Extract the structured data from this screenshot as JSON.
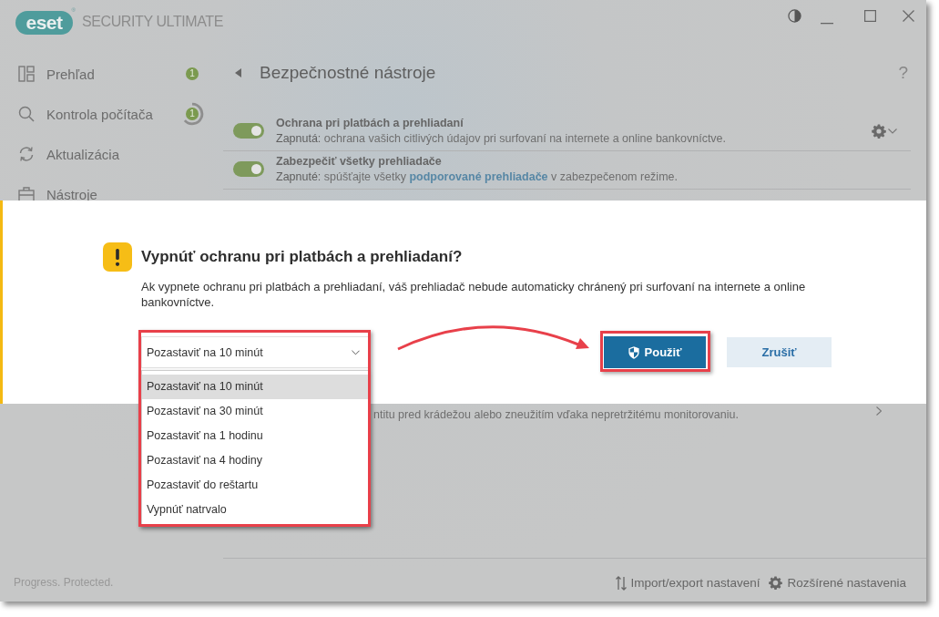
{
  "window": {
    "logo": "eset",
    "logo_mark": "®",
    "product": "SECURITY ULTIMATE"
  },
  "sidebar": {
    "items": [
      {
        "label": "Prehľad",
        "badge": "1",
        "busy": false
      },
      {
        "label": "Kontrola počítača",
        "badge": "1",
        "busy": true
      },
      {
        "label": "Aktualizácia"
      },
      {
        "label": "Nástroje"
      }
    ]
  },
  "page": {
    "title": "Bezpečnostné nástroje",
    "help": "?",
    "features": [
      {
        "title": "Ochrana pri platbách a prehliadaní",
        "on": true,
        "settings": true,
        "description": [
          {
            "kind": "status",
            "text": "Zapnutá:"
          },
          {
            "kind": "plain",
            "text": " ochrana vašich citlivých údajov pri surfovaní na internete a online bankovníctve."
          }
        ]
      },
      {
        "title": "Zabezpečiť všetky prehliadače",
        "on": true,
        "settings": false,
        "description": [
          {
            "kind": "status",
            "text": "Zapnuté:"
          },
          {
            "kind": "plain",
            "text": " spúšťajte všetky "
          },
          {
            "kind": "link",
            "text": "podporované prehliadače"
          },
          {
            "kind": "plain",
            "text": " v zabezpečenom režime."
          }
        ]
      }
    ],
    "covered_row": {
      "description": "ntitu pred krádežou alebo zneužitím vďaka nepretržitému monitorovaniu."
    }
  },
  "dialog": {
    "title": "Vypnúť ochranu pri platbách a prehliadaní?",
    "message": "Ak vypnete ochranu pri platbách a prehliadaní, váš prehliadač nebude automaticky chránený pri surfovaní na internete a online bankovníctve.",
    "select": {
      "value": "Pozastaviť na 10 minút",
      "expanded": true,
      "options": [
        {
          "label": "Pozastaviť na 10 minút",
          "selected": true
        },
        {
          "label": "Pozastaviť na 30 minút",
          "selected": false
        },
        {
          "label": "Pozastaviť na 1 hodinu",
          "selected": false
        },
        {
          "label": "Pozastaviť na 4 hodiny",
          "selected": false
        },
        {
          "label": "Pozastaviť do reštartu",
          "selected": false
        },
        {
          "label": "Vypnúť natrvalo",
          "selected": false
        }
      ]
    },
    "buttons": [
      {
        "label": "Použiť",
        "kind": "primary"
      },
      {
        "label": "Zrušiť",
        "kind": "secondary"
      }
    ]
  },
  "footer": {
    "tagline": "Progress. Protected.",
    "links": [
      "Import/export nastavení",
      "Rozšírené nastavenia"
    ]
  }
}
